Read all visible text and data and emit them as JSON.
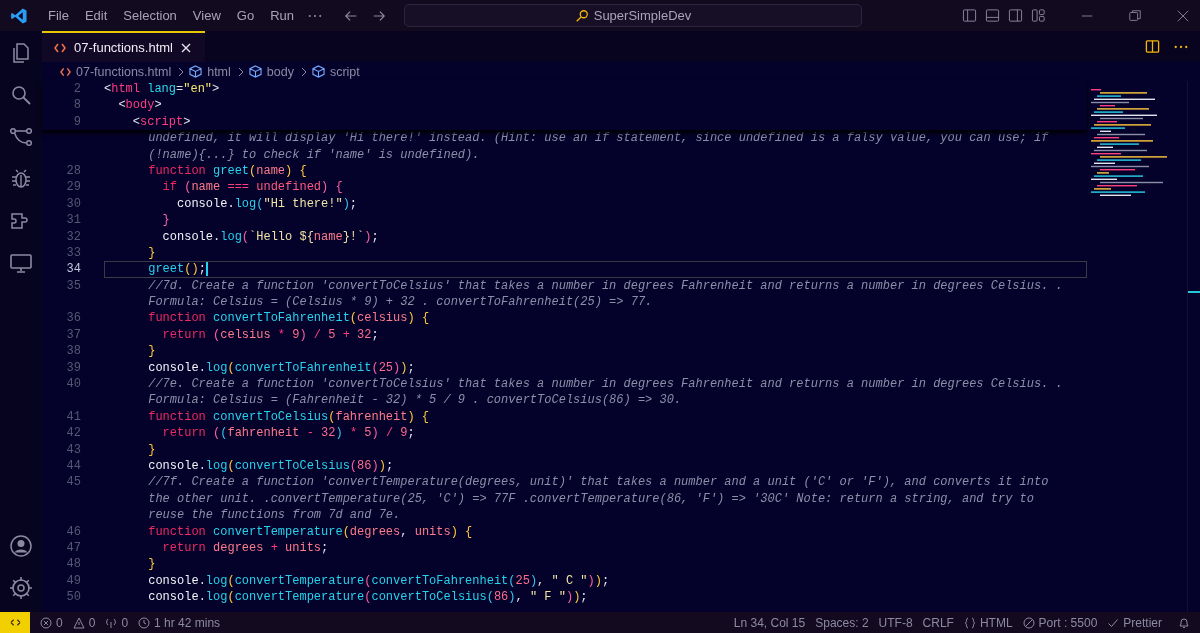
{
  "title_bar": {
    "menu": [
      "File",
      "Edit",
      "Selection",
      "View",
      "Go",
      "Run"
    ],
    "command_center": "SuperSimpleDev"
  },
  "tabs": [
    {
      "label": "07-functions.html",
      "selected": true
    }
  ],
  "breadcrumbs": [
    "07-functions.html",
    "html",
    "body",
    "script"
  ],
  "sticky_lines": [
    {
      "num": "2",
      "tokens": [
        {
          "kind": "p",
          "text": "<"
        },
        {
          "kind": "tag",
          "text": "html "
        },
        {
          "kind": "attr",
          "text": "lang"
        },
        {
          "kind": "p",
          "text": "="
        },
        {
          "kind": "str2",
          "text": "\"en\""
        },
        {
          "kind": "p",
          "text": ">"
        }
      ]
    },
    {
      "num": "8",
      "tokens": [
        {
          "kind": "p",
          "text": "  <"
        },
        {
          "kind": "tag",
          "text": "body"
        },
        {
          "kind": "p",
          "text": ">"
        }
      ]
    },
    {
      "num": "9",
      "tokens": [
        {
          "kind": "p",
          "text": "    <"
        },
        {
          "kind": "tag",
          "text": "script"
        },
        {
          "kind": "p",
          "text": ">"
        }
      ]
    }
  ],
  "lines": [
    {
      "current": false,
      "tokens": [
        {
          "kind": "cm",
          "text": "      undefined, it will display 'Hi there!' instead. (Hint: use an if statement, since undefined is a falsy value, you can use; if"
        }
      ]
    },
    {
      "current": false,
      "tokens": [
        {
          "kind": "cm",
          "text": "      (!name){...} to check if 'name' is undefined)."
        }
      ]
    },
    {
      "num": "28",
      "current": false,
      "tokens": [
        {
          "kind": "kw",
          "text": "      function "
        },
        {
          "kind": "fn",
          "text": "greet"
        },
        {
          "kind": "b1",
          "text": "("
        },
        {
          "kind": "pa",
          "text": "name"
        },
        {
          "kind": "b1",
          "text": ") {"
        }
      ]
    },
    {
      "num": "29",
      "current": false,
      "tokens": [
        {
          "kind": "kw",
          "text": "        if "
        },
        {
          "kind": "b2",
          "text": "("
        },
        {
          "kind": "pa",
          "text": "name "
        },
        {
          "kind": "op",
          "text": "=== "
        },
        {
          "kind": "un",
          "text": "undefined"
        },
        {
          "kind": "b2",
          "text": ") {"
        }
      ]
    },
    {
      "num": "30",
      "current": false,
      "tokens": [
        {
          "kind": "cn",
          "text": "          console"
        },
        {
          "kind": "p",
          "text": "."
        },
        {
          "kind": "fn",
          "text": "log"
        },
        {
          "kind": "b3",
          "text": "("
        },
        {
          "kind": "str",
          "text": "\"Hi there!\""
        },
        {
          "kind": "b3",
          "text": ")"
        },
        {
          "kind": "p",
          "text": ";"
        }
      ]
    },
    {
      "num": "31",
      "current": false,
      "tokens": [
        {
          "kind": "b2",
          "text": "        }"
        }
      ]
    },
    {
      "num": "32",
      "current": false,
      "tokens": [
        {
          "kind": "cn",
          "text": "        console"
        },
        {
          "kind": "p",
          "text": "."
        },
        {
          "kind": "fn",
          "text": "log"
        },
        {
          "kind": "b2",
          "text": "("
        },
        {
          "kind": "str",
          "text": "`Hello ${"
        },
        {
          "kind": "pa",
          "text": "name"
        },
        {
          "kind": "str",
          "text": "}!`"
        },
        {
          "kind": "b2",
          "text": ")"
        },
        {
          "kind": "p",
          "text": ";"
        }
      ]
    },
    {
      "num": "33",
      "current": false,
      "tokens": [
        {
          "kind": "b1",
          "text": "      }"
        }
      ]
    },
    {
      "num": "34",
      "current": true,
      "tokens": [
        {
          "kind": "fn",
          "text": "      greet"
        },
        {
          "kind": "b1",
          "text": "()"
        },
        {
          "kind": "p",
          "text": ";"
        }
      ]
    },
    {
      "num": "35",
      "current": false,
      "tokens": [
        {
          "kind": "cm",
          "text": "      //7d. Create a function 'convertToCelsius' that takes a number in degrees Fahrenheit and returns a number in degrees Celsius. ."
        }
      ]
    },
    {
      "current": false,
      "tokens": [
        {
          "kind": "cm",
          "text": "      Formula: Celsius = (Celsius * 9) + 32 . convertToFahrenheit(25) => 77."
        }
      ]
    },
    {
      "num": "36",
      "current": false,
      "tokens": [
        {
          "kind": "kw",
          "text": "      function "
        },
        {
          "kind": "fn",
          "text": "convertToFahrenheit"
        },
        {
          "kind": "b1",
          "text": "("
        },
        {
          "kind": "pa",
          "text": "celsius"
        },
        {
          "kind": "b1",
          "text": ") {"
        }
      ]
    },
    {
      "num": "37",
      "current": false,
      "tokens": [
        {
          "kind": "kw",
          "text": "        return "
        },
        {
          "kind": "b2",
          "text": "("
        },
        {
          "kind": "pa",
          "text": "celsius "
        },
        {
          "kind": "op",
          "text": "* "
        },
        {
          "kind": "nu",
          "text": "9"
        },
        {
          "kind": "b2",
          "text": ") "
        },
        {
          "kind": "op",
          "text": "/ "
        },
        {
          "kind": "nu",
          "text": "5 "
        },
        {
          "kind": "op",
          "text": "+ "
        },
        {
          "kind": "nu",
          "text": "32"
        },
        {
          "kind": "p",
          "text": ";"
        }
      ]
    },
    {
      "num": "38",
      "current": false,
      "tokens": [
        {
          "kind": "b1",
          "text": "      }"
        }
      ]
    },
    {
      "num": "39",
      "current": false,
      "tokens": [
        {
          "kind": "cn",
          "text": "      console"
        },
        {
          "kind": "p",
          "text": "."
        },
        {
          "kind": "fn",
          "text": "log"
        },
        {
          "kind": "b1",
          "text": "("
        },
        {
          "kind": "fn",
          "text": "convertToFahrenheit"
        },
        {
          "kind": "b2",
          "text": "("
        },
        {
          "kind": "nu",
          "text": "25"
        },
        {
          "kind": "b2",
          "text": ")"
        },
        {
          "kind": "b1",
          "text": ")"
        },
        {
          "kind": "p",
          "text": ";"
        }
      ]
    },
    {
      "num": "40",
      "current": false,
      "tokens": [
        {
          "kind": "cm",
          "text": "      //7e. Create a function 'convertToCelsius' that takes a number in degrees Fahrenheit and returns a number in degrees Celsius. ."
        }
      ]
    },
    {
      "current": false,
      "tokens": [
        {
          "kind": "cm",
          "text": "      Formula: Celsius = (Fahrenheit - 32) * 5 / 9 . convertToCelsius(86) => 30."
        }
      ]
    },
    {
      "num": "41",
      "current": false,
      "tokens": [
        {
          "kind": "kw",
          "text": "      function "
        },
        {
          "kind": "fn",
          "text": "convertToCelsius"
        },
        {
          "kind": "b1",
          "text": "("
        },
        {
          "kind": "pa",
          "text": "fahrenheit"
        },
        {
          "kind": "b1",
          "text": ") {"
        }
      ]
    },
    {
      "num": "42",
      "current": false,
      "tokens": [
        {
          "kind": "kw",
          "text": "        return "
        },
        {
          "kind": "b2",
          "text": "("
        },
        {
          "kind": "b3",
          "text": "("
        },
        {
          "kind": "pa",
          "text": "fahrenheit "
        },
        {
          "kind": "op",
          "text": "- "
        },
        {
          "kind": "nu",
          "text": "32"
        },
        {
          "kind": "b3",
          "text": ") "
        },
        {
          "kind": "op",
          "text": "* "
        },
        {
          "kind": "nu",
          "text": "5"
        },
        {
          "kind": "b2",
          "text": ") "
        },
        {
          "kind": "op",
          "text": "/ "
        },
        {
          "kind": "nu",
          "text": "9"
        },
        {
          "kind": "p",
          "text": ";"
        }
      ]
    },
    {
      "num": "43",
      "current": false,
      "tokens": [
        {
          "kind": "b1",
          "text": "      }"
        }
      ]
    },
    {
      "num": "44",
      "current": false,
      "tokens": [
        {
          "kind": "cn",
          "text": "      console"
        },
        {
          "kind": "p",
          "text": "."
        },
        {
          "kind": "fn",
          "text": "log"
        },
        {
          "kind": "b1",
          "text": "("
        },
        {
          "kind": "fn",
          "text": "convertToCelsius"
        },
        {
          "kind": "b2",
          "text": "("
        },
        {
          "kind": "nu",
          "text": "86"
        },
        {
          "kind": "b2",
          "text": ")"
        },
        {
          "kind": "b1",
          "text": ")"
        },
        {
          "kind": "p",
          "text": ";"
        }
      ]
    },
    {
      "num": "45",
      "current": false,
      "tokens": [
        {
          "kind": "cm",
          "text": "      //7f. Create a function 'convertTemperature(degrees, unit)' that takes a number and a unit ('C' or 'F'), and converts it into"
        }
      ]
    },
    {
      "current": false,
      "tokens": [
        {
          "kind": "cm",
          "text": "      the other unit. .convertTemperature(25, 'C') => 77F .convertTemperature(86, 'F') => '30C' Note: return a string, and try to"
        }
      ]
    },
    {
      "current": false,
      "tokens": [
        {
          "kind": "cm",
          "text": "      reuse the functions from 7d and 7e."
        }
      ]
    },
    {
      "num": "46",
      "current": false,
      "tokens": [
        {
          "kind": "kw",
          "text": "      function "
        },
        {
          "kind": "fn",
          "text": "convertTemperature"
        },
        {
          "kind": "b1",
          "text": "("
        },
        {
          "kind": "pa",
          "text": "degrees"
        },
        {
          "kind": "p",
          "text": ", "
        },
        {
          "kind": "pa",
          "text": "units"
        },
        {
          "kind": "b1",
          "text": ") {"
        }
      ]
    },
    {
      "num": "47",
      "current": false,
      "tokens": [
        {
          "kind": "kw",
          "text": "        return "
        },
        {
          "kind": "pa",
          "text": "degrees "
        },
        {
          "kind": "op",
          "text": "+ "
        },
        {
          "kind": "pa",
          "text": "units"
        },
        {
          "kind": "p",
          "text": ";"
        }
      ]
    },
    {
      "num": "48",
      "current": false,
      "tokens": [
        {
          "kind": "b1",
          "text": "      }"
        }
      ]
    },
    {
      "num": "49",
      "current": false,
      "tokens": [
        {
          "kind": "cn",
          "text": "      console"
        },
        {
          "kind": "p",
          "text": "."
        },
        {
          "kind": "fn",
          "text": "log"
        },
        {
          "kind": "b1",
          "text": "("
        },
        {
          "kind": "fn",
          "text": "convertTemperature"
        },
        {
          "kind": "b2",
          "text": "("
        },
        {
          "kind": "fn",
          "text": "convertToFahrenheit"
        },
        {
          "kind": "b3",
          "text": "("
        },
        {
          "kind": "nu",
          "text": "25"
        },
        {
          "kind": "b3",
          "text": ")"
        },
        {
          "kind": "p",
          "text": ", "
        },
        {
          "kind": "str",
          "text": "\" C \""
        },
        {
          "kind": "b2",
          "text": ")"
        },
        {
          "kind": "b1",
          "text": ")"
        },
        {
          "kind": "p",
          "text": ";"
        }
      ]
    },
    {
      "num": "50",
      "current": false,
      "tokens": [
        {
          "kind": "cn",
          "text": "      console"
        },
        {
          "kind": "p",
          "text": "."
        },
        {
          "kind": "fn",
          "text": "log"
        },
        {
          "kind": "b1",
          "text": "("
        },
        {
          "kind": "fn",
          "text": "convertTemperature"
        },
        {
          "kind": "b2",
          "text": "("
        },
        {
          "kind": "fn",
          "text": "convertToCelsius"
        },
        {
          "kind": "b3",
          "text": "("
        },
        {
          "kind": "nu",
          "text": "86"
        },
        {
          "kind": "b3",
          "text": ")"
        },
        {
          "kind": "p",
          "text": ", "
        },
        {
          "kind": "str",
          "text": "\" F \""
        },
        {
          "kind": "b2",
          "text": ")"
        },
        {
          "kind": "b1",
          "text": ")"
        },
        {
          "kind": "p",
          "text": ";"
        }
      ]
    }
  ],
  "status_bar": {
    "left": [
      {
        "kind": "error",
        "text": "0"
      },
      {
        "kind": "warning",
        "text": "0"
      },
      {
        "kind": "broadcast",
        "text": "0"
      },
      {
        "kind": "clock",
        "text": "1 hr 42 mins"
      }
    ],
    "right": [
      {
        "kind": "text",
        "text": "Ln 34, Col 15"
      },
      {
        "kind": "text",
        "text": "Spaces: 2"
      },
      {
        "kind": "text",
        "text": "UTF-8"
      },
      {
        "kind": "text",
        "text": "CRLF"
      },
      {
        "kind": "braces",
        "text": "HTML"
      },
      {
        "kind": "no-entry",
        "text": "Port : 5500"
      },
      {
        "kind": "check",
        "text": "Prettier"
      }
    ]
  }
}
